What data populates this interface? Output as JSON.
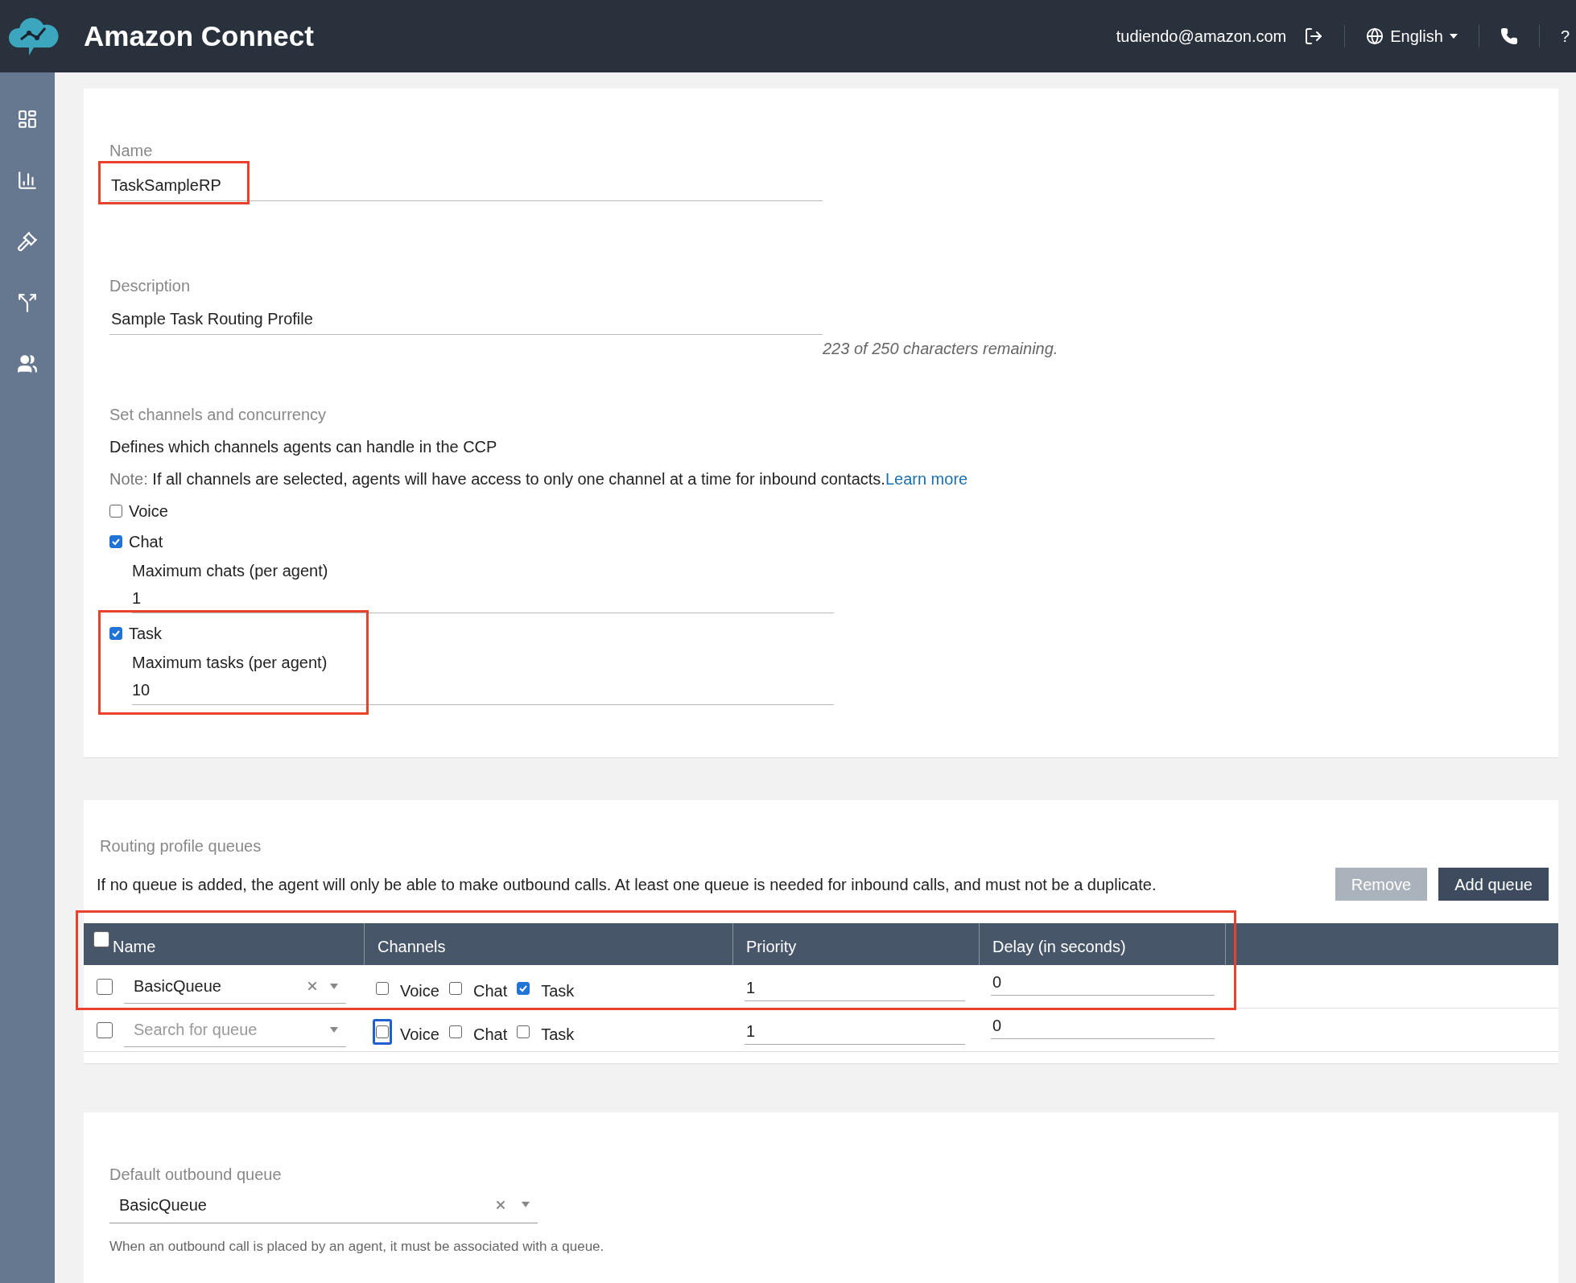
{
  "header": {
    "app_title": "Amazon Connect",
    "user_email": "tudiendo@amazon.com",
    "language": "English",
    "help": "?"
  },
  "profile": {
    "name": {
      "label": "Name",
      "value": "TaskSampleRP",
      "highlighted": true
    },
    "description": {
      "label": "Description",
      "value": "Sample Task Routing Profile",
      "remaining": "223 of 250 characters remaining."
    },
    "channels_section": {
      "heading": "Set channels and concurrency",
      "subtitle": "Defines which channels agents can handle in the CCP",
      "note_label": "Note:",
      "note_text": " If all channels are selected, agents will have access to only one channel at a time for inbound contacts.",
      "learn_more": "Learn more"
    },
    "channels": [
      {
        "label": "Voice",
        "checked": false,
        "highlighted": false
      },
      {
        "label": "Chat",
        "checked": true,
        "highlighted": false,
        "max_label": "Maximum chats (per agent)",
        "max_value": "1"
      },
      {
        "label": "Task",
        "checked": true,
        "highlighted": true,
        "max_label": "Maximum tasks (per agent)",
        "max_value": "10"
      }
    ]
  },
  "queues": {
    "heading": "Routing profile queues",
    "description": "If no queue is added, the agent will only be able to make outbound calls. At least one queue is needed for inbound calls, and must not be a duplicate.",
    "buttons": [
      {
        "label": "Remove",
        "disabled": true
      },
      {
        "label": "Add queue",
        "disabled": false
      }
    ],
    "table": {
      "highlighted": true,
      "header_checked": false,
      "columns": [
        "Name",
        "Channels",
        "Priority",
        "Delay (in seconds)"
      ],
      "rows": [
        {
          "selected": false,
          "queue": {
            "value": "BasicQueue"
          },
          "channels": [
            {
              "label": "Voice",
              "checked": false,
              "focused": false
            },
            {
              "label": "Chat",
              "checked": false,
              "focused": false
            },
            {
              "label": "Task",
              "checked": true,
              "focused": false
            }
          ],
          "priority": "1",
          "delay": "0"
        },
        {
          "selected": false,
          "queue": {
            "placeholder": "Search for queue"
          },
          "channels": [
            {
              "label": "Voice",
              "checked": false,
              "focused": true
            },
            {
              "label": "Chat",
              "checked": false,
              "focused": false
            },
            {
              "label": "Task",
              "checked": false,
              "focused": false
            }
          ],
          "priority": "1",
          "delay": "0"
        }
      ]
    }
  },
  "default_outbound": {
    "label": "Default outbound queue",
    "value": "BasicQueue",
    "help": "When an outbound call is placed by an agent, it must be associated with a queue."
  }
}
